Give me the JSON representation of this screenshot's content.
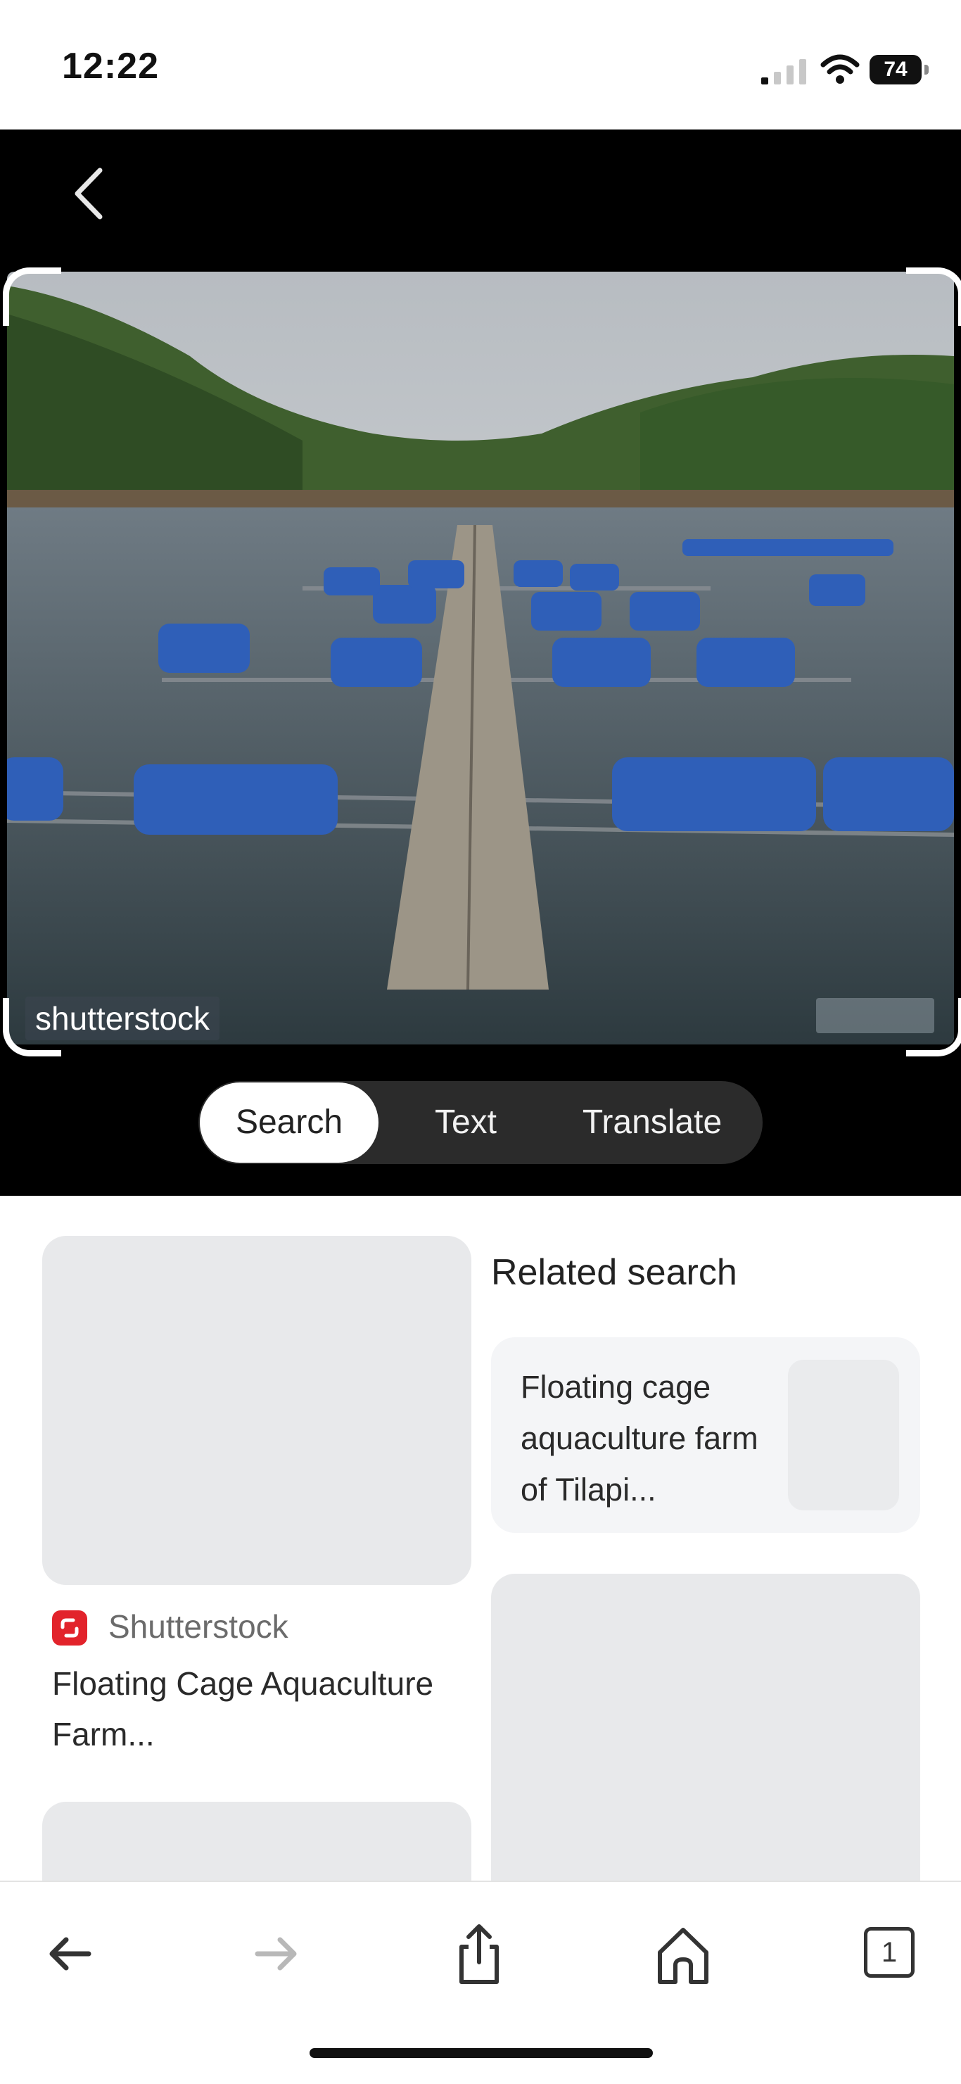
{
  "status_bar": {
    "time": "12:22",
    "battery": "74"
  },
  "photo": {
    "watermark": "shutterstock"
  },
  "modes": {
    "search": "Search",
    "text": "Text",
    "translate": "Translate",
    "selected": "Search"
  },
  "results": {
    "first": {
      "source": "Shutterstock",
      "title": "Floating Cage Aquaculture Farm..."
    }
  },
  "related": {
    "heading": "Related search",
    "items": [
      {
        "label": "Floating cage aquaculture farm of Tilapi..."
      }
    ]
  },
  "bottom_nav": {
    "tab_count": "1"
  },
  "colors": {
    "accent_source": "#e2232b",
    "dark_background": "#000000",
    "mode_bar": "#2b2b2b"
  }
}
